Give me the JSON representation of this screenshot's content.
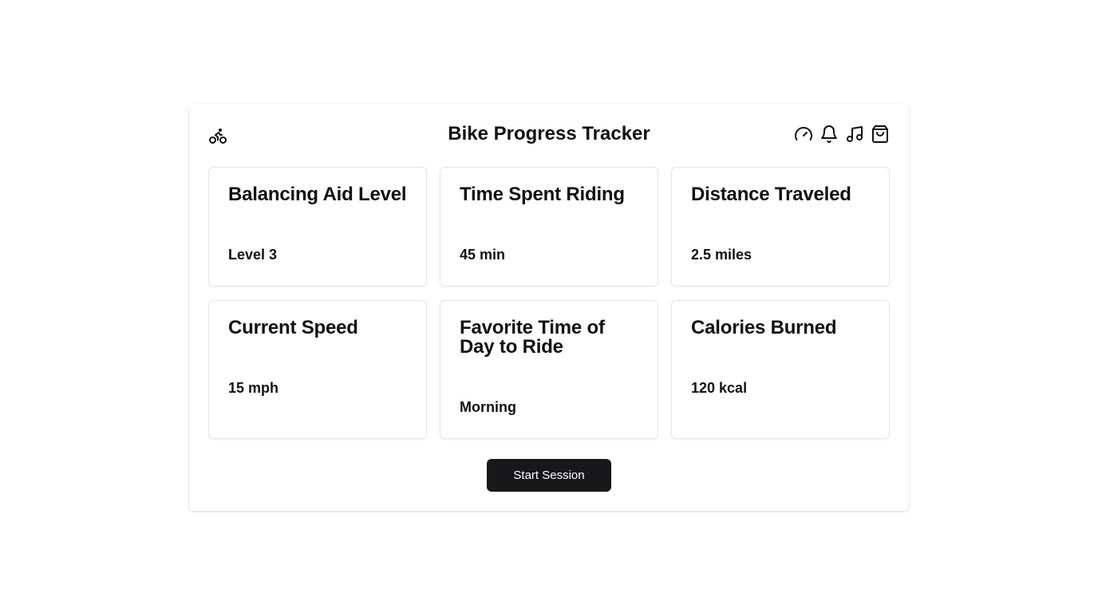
{
  "header": {
    "title": "Bike Progress Tracker",
    "logo_icon": "bike-icon",
    "icons": [
      "gauge-icon",
      "bell-icon",
      "music-icon",
      "shopping-bag-icon"
    ]
  },
  "cards": [
    {
      "title": "Balancing Aid Level",
      "value": "Level 3"
    },
    {
      "title": "Time Spent Riding",
      "value": "45 min"
    },
    {
      "title": "Distance Traveled",
      "value": "2.5 miles"
    },
    {
      "title": "Current Speed",
      "value": "15 mph"
    },
    {
      "title": "Favorite Time of Day to Ride",
      "value": "Morning"
    },
    {
      "title": "Calories Burned",
      "value": "120 kcal"
    }
  ],
  "actions": {
    "start_label": "Start Session"
  },
  "colors": {
    "button_bg": "#18181b",
    "text": "#111111",
    "card_border": "#e5e5e5"
  }
}
